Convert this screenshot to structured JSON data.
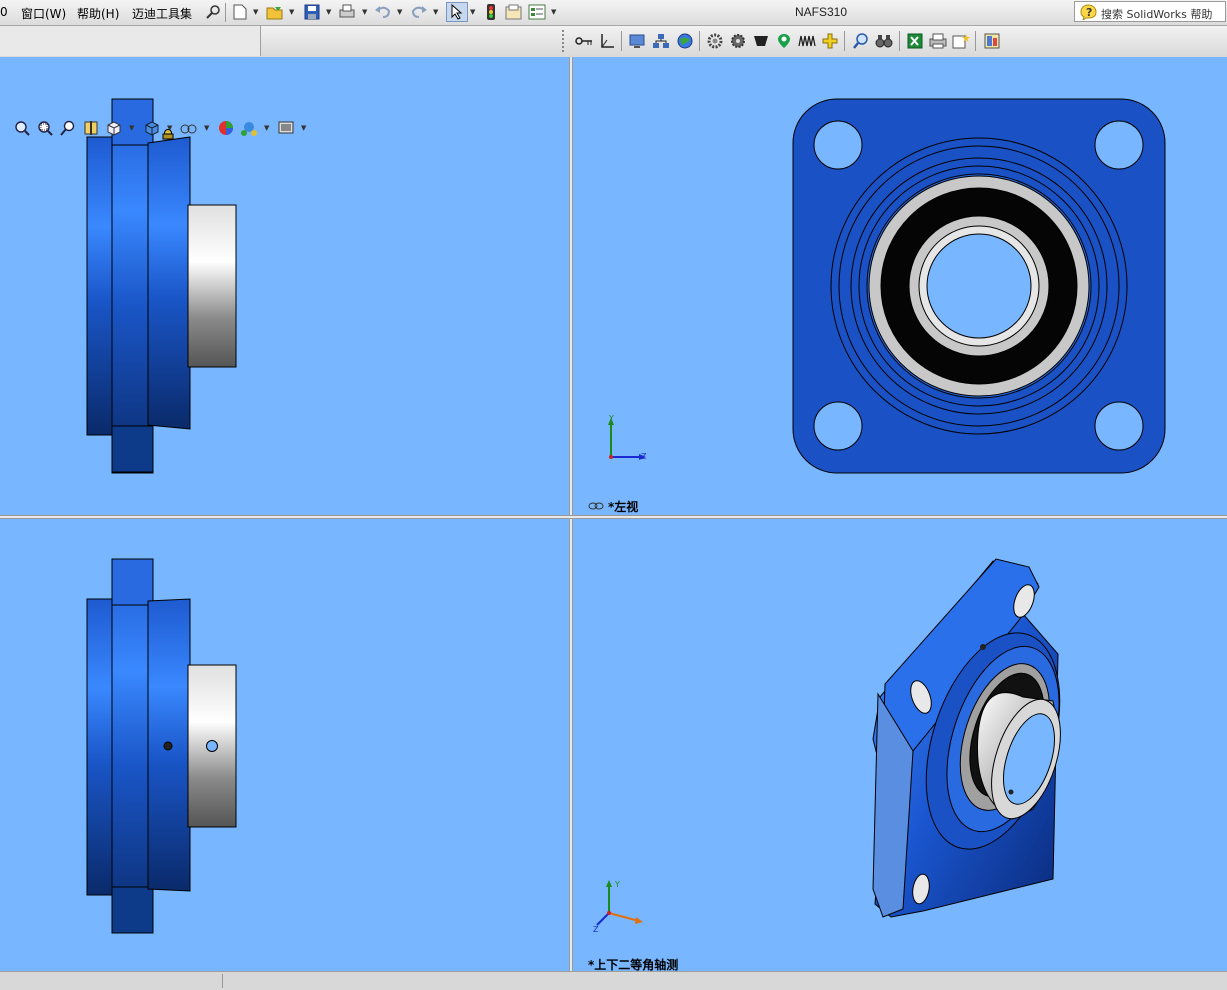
{
  "menubar": {
    "items": [
      {
        "label": "0",
        "name": "menu-help-fragment"
      },
      {
        "label": "窗口(W)",
        "name": "menu-window"
      },
      {
        "label": "帮助(H)",
        "name": "menu-help"
      },
      {
        "label": "迈迪工具集",
        "name": "menu-maidi-tools"
      }
    ],
    "doc_title": "NAFS310",
    "search_placeholder": "搜索 SolidWorks 帮助"
  },
  "toolbar_icons": [
    "pin-icon",
    "new-document-icon",
    "open-icon",
    "save-icon",
    "print-icon",
    "undo-icon",
    "redo-icon",
    "select-icon",
    "rebuild-icon",
    "file-properties-icon",
    "options-icon"
  ],
  "command_icons": [
    "key-icon",
    "sketch-icon",
    "monitor-icon",
    "assembly-icon",
    "globe-icon",
    "gear-icon",
    "cog-icon",
    "funnel-icon",
    "map-pin-icon",
    "spring-icon",
    "move-icon",
    "zoom-icon",
    "binoculars-icon",
    "excel-icon",
    "printer-icon",
    "star-document-icon",
    "help-document-icon"
  ],
  "hud_icons": [
    "zoom-to-fit-icon",
    "zoom-area-icon",
    "previous-view-icon",
    "section-view-icon",
    "view-orientation-icon",
    "display-style-icon",
    "hide-show-icon",
    "edit-appearance-icon",
    "apply-scene-icon",
    "view-settings-icon"
  ],
  "viewports": {
    "top_right_label": "*左视",
    "bottom_right_label": "*上下二等角轴测",
    "triad_y": "Y",
    "triad_z": "Z"
  },
  "colors": {
    "viewport_bg": "#78b7ff",
    "part_blue": "#1f5fd6",
    "part_dark": "#0a2a66"
  }
}
